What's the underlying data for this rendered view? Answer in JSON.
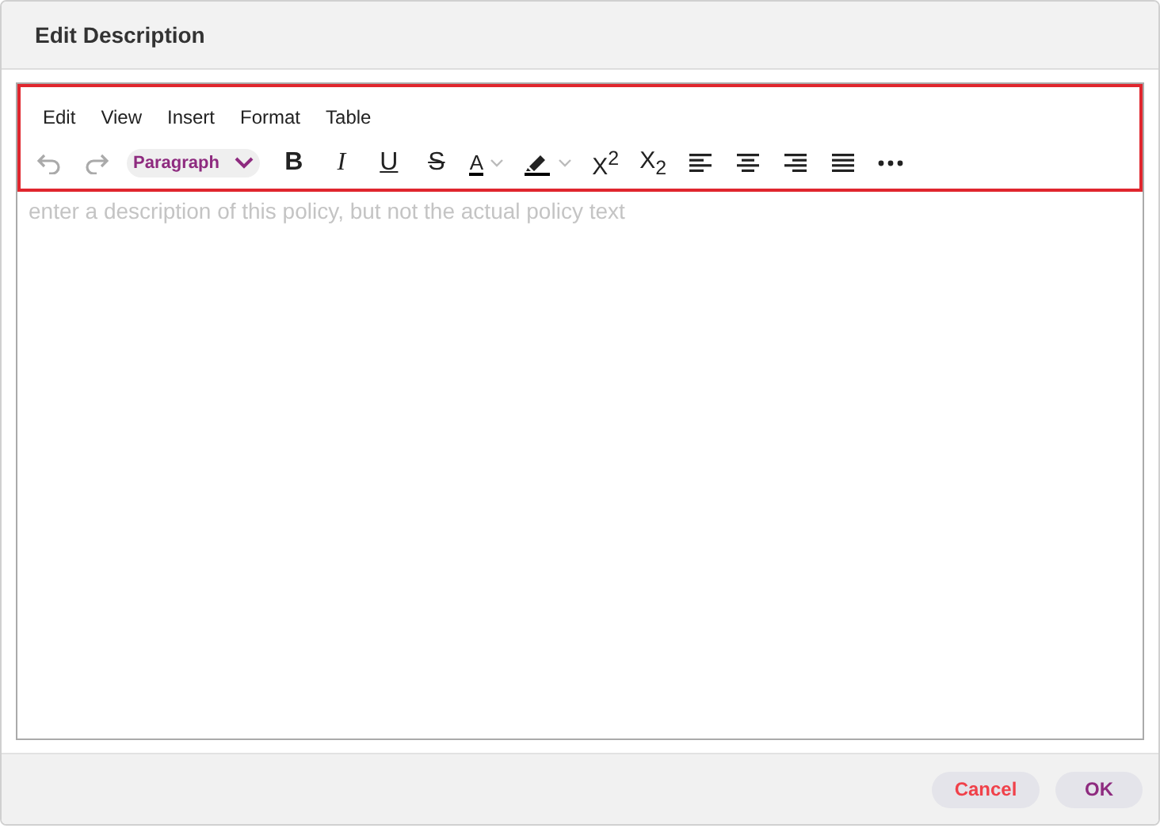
{
  "dialog": {
    "title": "Edit Description"
  },
  "menubar": [
    "Edit",
    "View",
    "Insert",
    "Format",
    "Table"
  ],
  "toolbar": [
    {
      "kind": "undo",
      "disabled": true
    },
    {
      "kind": "redo",
      "disabled": true
    },
    {
      "kind": "block-select",
      "label": "Paragraph"
    },
    {
      "kind": "bold",
      "label": "B"
    },
    {
      "kind": "italic",
      "label": "I"
    },
    {
      "kind": "underline",
      "label": "U"
    },
    {
      "kind": "strike",
      "label": "S"
    },
    {
      "kind": "text-color",
      "label": "A"
    },
    {
      "kind": "highlight"
    },
    {
      "kind": "superscript",
      "label": "X$^{2}$"
    },
    {
      "kind": "subscript",
      "label": "X$_{2}$"
    },
    {
      "kind": "align-left"
    },
    {
      "kind": "align-center"
    },
    {
      "kind": "align-right"
    },
    {
      "kind": "justify"
    },
    {
      "kind": "more"
    }
  ],
  "editor": {
    "placeholder": "enter a description of this policy, but not the actual policy text"
  },
  "buttons": [
    {
      "kind": "cancel",
      "label": "Cancel"
    },
    {
      "kind": "ok",
      "label": "OK"
    }
  ]
}
